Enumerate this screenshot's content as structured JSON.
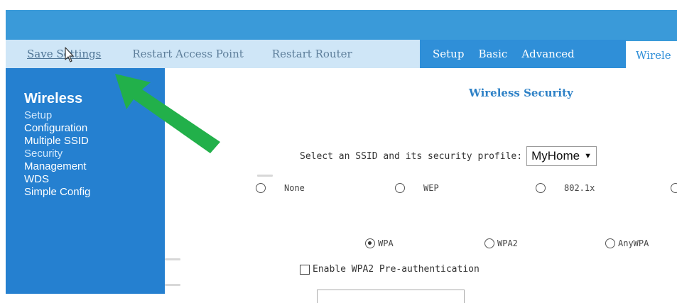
{
  "nav": {
    "save_settings": "Save Settings",
    "restart_ap": "Restart Access Point",
    "restart_router": "Restart Router",
    "tabs": [
      "Setup",
      "Basic",
      "Advanced"
    ],
    "active_tab": "Wirele"
  },
  "sidebar": {
    "heading": "Wireless",
    "items": [
      {
        "label": "Setup"
      },
      {
        "label": "Configuration"
      },
      {
        "label": "Multiple SSID"
      },
      {
        "label": "Security"
      },
      {
        "label": "Management"
      },
      {
        "label": "WDS"
      },
      {
        "label": "Simple Config"
      }
    ]
  },
  "main": {
    "section_title": "Wireless Security",
    "ssid_label": "Select an SSID and its security profile:",
    "ssid_value": "MyHome",
    "security_options": [
      {
        "label": "None",
        "checked": false
      },
      {
        "label": "WEP",
        "checked": false
      },
      {
        "label": "802.1x",
        "checked": false
      }
    ],
    "wpa_options": [
      {
        "label": "WPA",
        "checked": true
      },
      {
        "label": "WPA2",
        "checked": false
      },
      {
        "label": "AnyWPA",
        "checked": false
      }
    ],
    "preauth_label": "Enable WPA2 Pre-authentication",
    "preauth_checked": false
  },
  "colors": {
    "header": "#3a9ad9",
    "nav_light": "#cfe6f7",
    "nav_dark": "#2f8fd8",
    "sidebar": "#2580d0",
    "title": "#2c80c6",
    "arrow": "#22b04a"
  },
  "icons": {
    "cursor": "pointer-cursor-icon",
    "arrow": "green-arrow-icon",
    "caret": "chevron-down-icon"
  }
}
